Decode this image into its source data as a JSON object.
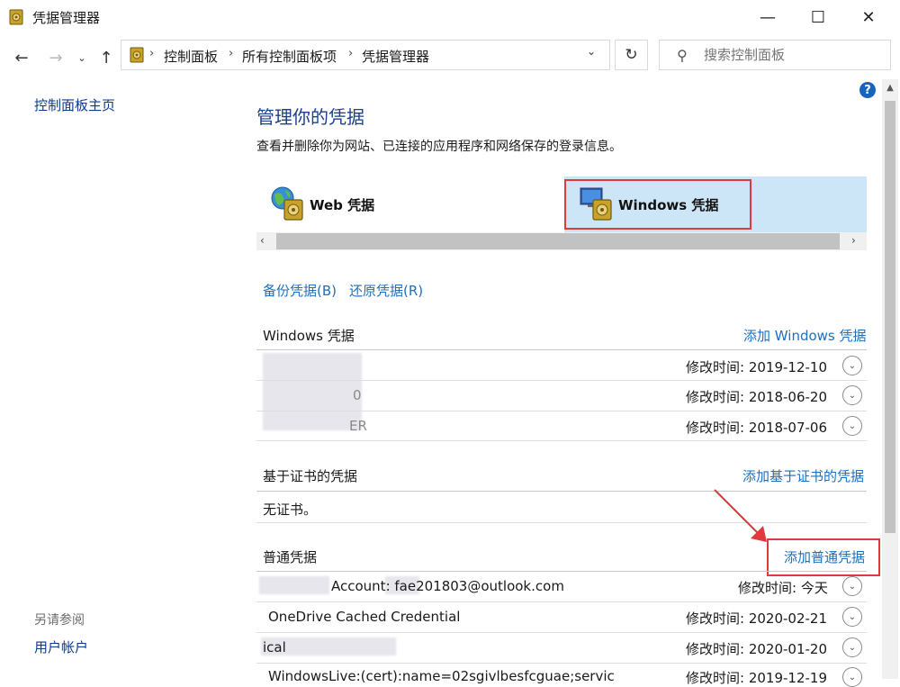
{
  "window": {
    "title": "凭据管理器",
    "min": "—",
    "max": "☐",
    "close": "✕"
  },
  "nav": {
    "back": "←",
    "forward": "→",
    "recent": "⌄",
    "up": "↑",
    "breadcrumb": [
      "控制面板",
      "所有控制面板项",
      "凭据管理器"
    ],
    "sep": "›",
    "dropdown": "⌄",
    "refresh": "↻",
    "search_placeholder": "搜索控制面板"
  },
  "left_pane": {
    "home": "控制面板主页",
    "see_also": "另请参阅",
    "user_accounts": "用户帐户"
  },
  "help": "?",
  "main": {
    "title": "管理你的凭据",
    "description": "查看并删除你为网站、已连接的应用程序和网络保存的登录信息。",
    "tabs": [
      {
        "label": "Web 凭据",
        "selected": false
      },
      {
        "label": "Windows 凭据",
        "selected": true
      }
    ],
    "hscroll_left": "‹",
    "hscroll_right": "›",
    "backup": "备份凭据(B)",
    "restore": "还原凭据(R)",
    "sections": {
      "windows": {
        "title": "Windows 凭据",
        "add": "添加 Windows 凭据",
        "rows": [
          {
            "name": "",
            "modified": "修改时间:  2019-12-10"
          },
          {
            "name": "0",
            "modified": "修改时间:  2018-06-20"
          },
          {
            "name": "ER",
            "modified": "修改时间:  2018-07-06"
          }
        ]
      },
      "certificate": {
        "title": "基于证书的凭据",
        "add": "添加基于证书的凭据",
        "empty": "无证书。"
      },
      "generic": {
        "title": "普通凭据",
        "add": "添加普通凭据",
        "rows": [
          {
            "name": "Account:            fae201803@outlook.com",
            "modified": "修改时间:  今天"
          },
          {
            "name": "OneDrive Cached Credential",
            "modified": "修改时间:  2020-02-21"
          },
          {
            "name": "                   ical",
            "modified": "修改时间:  2020-01-20"
          },
          {
            "name": "WindowsLive:(cert):name=02sgivlbesfcguae;servic",
            "modified": "修改时间:  2019-12-19"
          }
        ]
      }
    }
  },
  "expand_glyph": "⌄",
  "colors": {
    "link": "#1e6fc0",
    "title": "#1c3f8f",
    "highlight_red": "#e0393e",
    "selected_tab": "#cde6f7"
  },
  "icons": {
    "app": "vault-icon",
    "web_tab": "globe-vault-icon",
    "windows_tab": "monitor-vault-icon"
  }
}
